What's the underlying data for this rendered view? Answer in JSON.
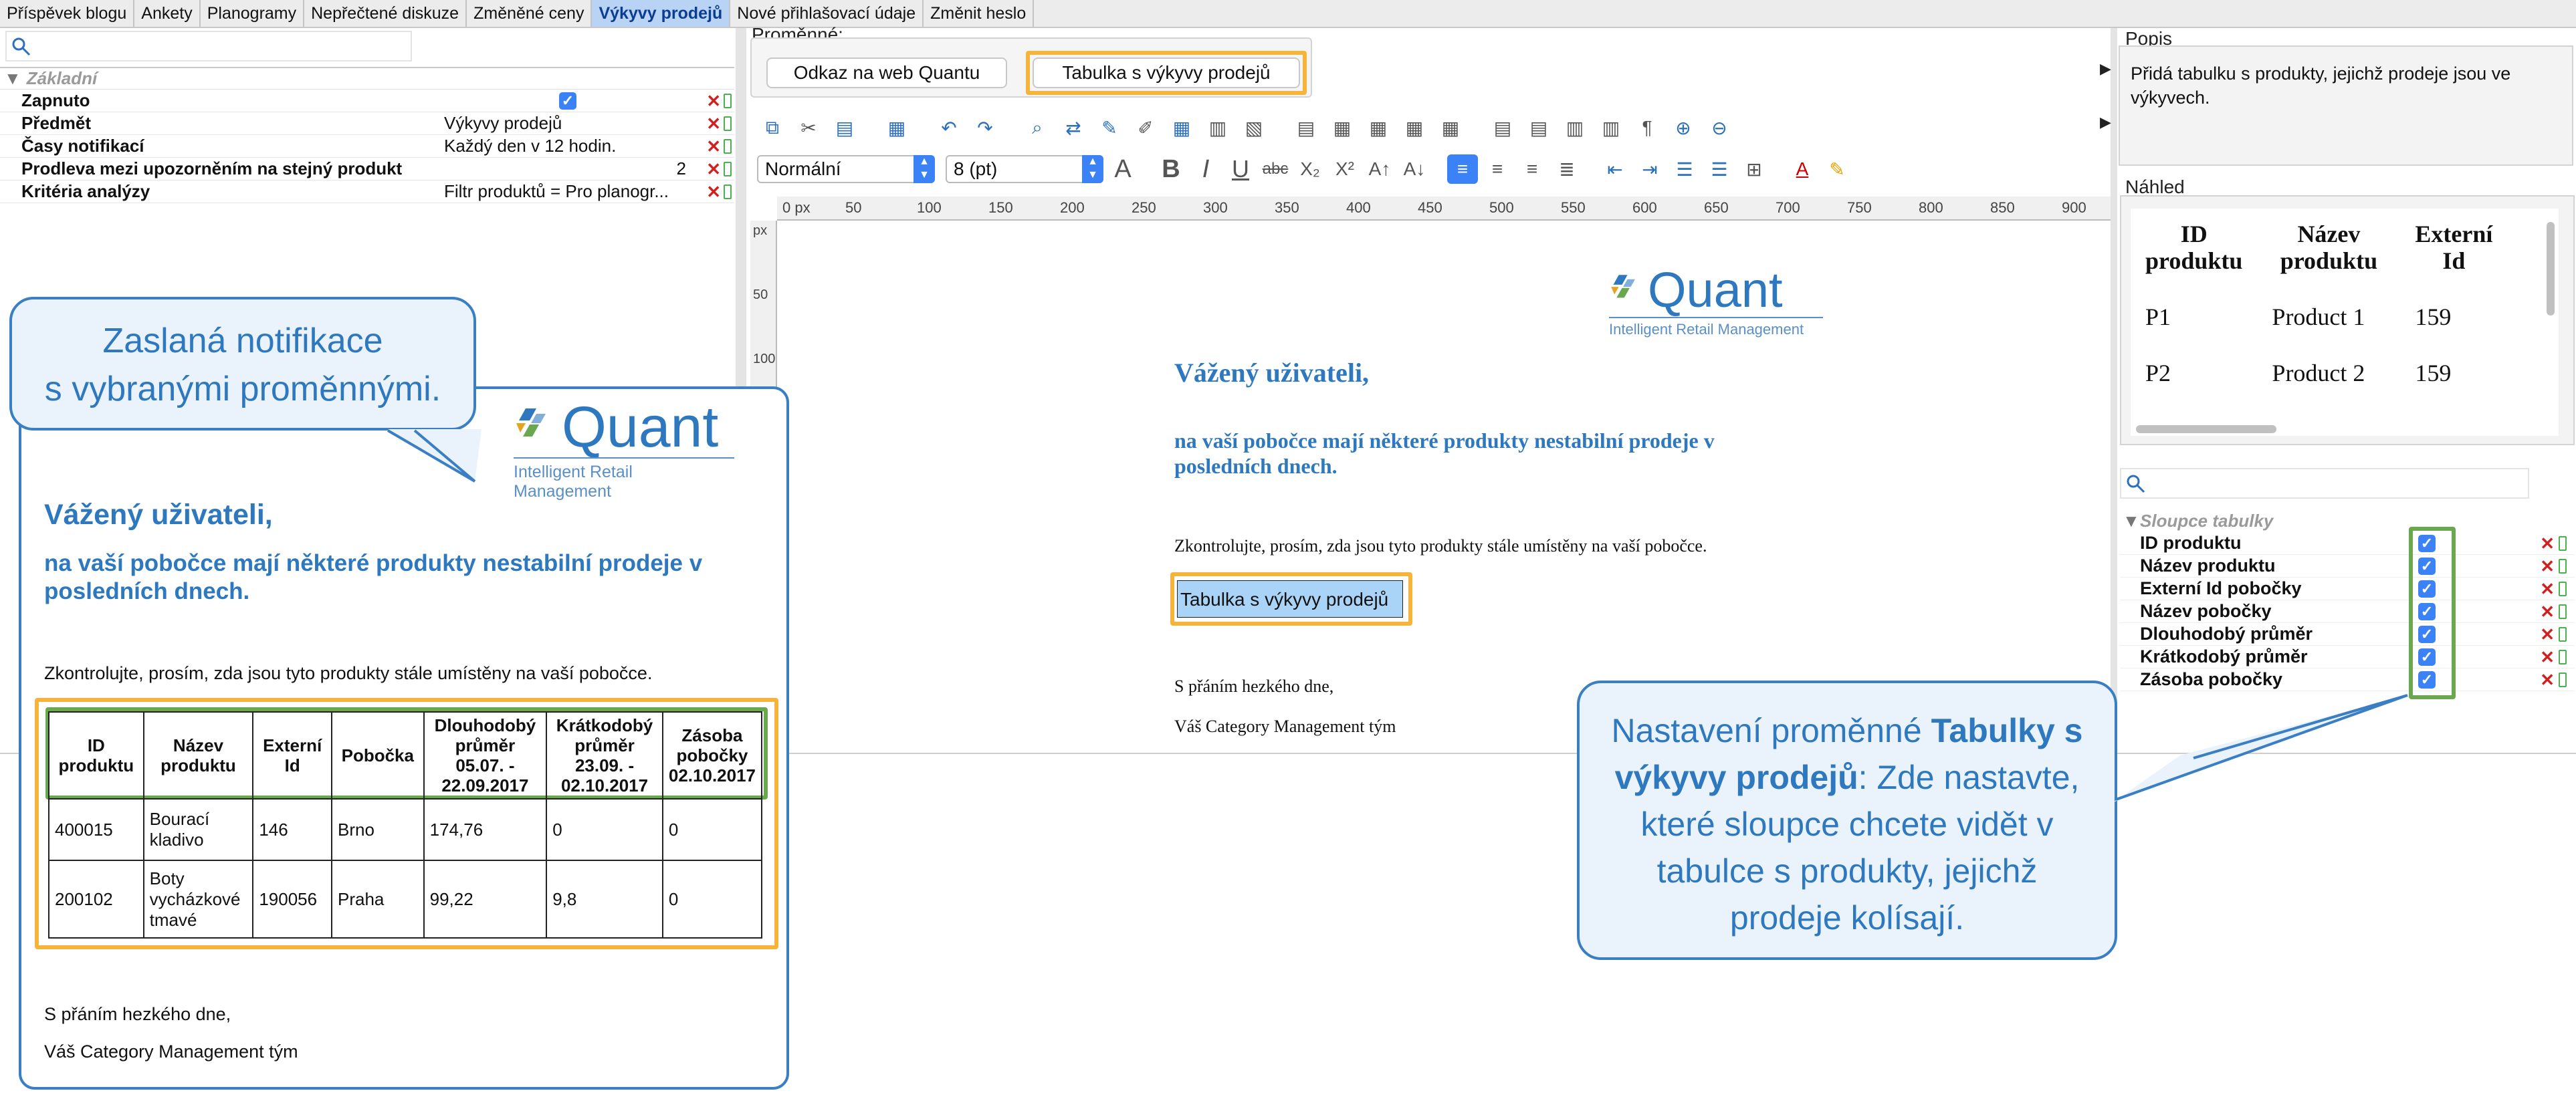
{
  "tabs": [
    {
      "label": "Příspěvek blogu",
      "active": false
    },
    {
      "label": "Ankety",
      "active": false
    },
    {
      "label": "Planogramy",
      "active": false
    },
    {
      "label": "Nepřečtené diskuze",
      "active": false
    },
    {
      "label": "Změněné ceny",
      "active": false
    },
    {
      "label": "Výkyvy prodejů",
      "active": true
    },
    {
      "label": "Nové přihlašovací údaje",
      "active": false
    },
    {
      "label": "Změnit heslo",
      "active": false
    }
  ],
  "properties": {
    "section": "Základní",
    "rows": [
      {
        "name": "Zapnuto",
        "value": "",
        "checkbox": true
      },
      {
        "name": "Předmět",
        "value": "Výkyvy prodejů"
      },
      {
        "name": "Časy notifikací",
        "value": "Každý den v 12 hodin."
      },
      {
        "name": "Prodleva mezi upozorněním na stejný produkt",
        "value": "2"
      },
      {
        "name": "Kritéria analýzy",
        "value": "Filtr produktů = Pro planogr..."
      }
    ]
  },
  "callout1": {
    "line1": "Zaslaná notifikace",
    "line2": "s vybranými proměnnými."
  },
  "callout2": {
    "pre": "Nastavení proměnné ",
    "bold": "Tabulky s výkyvy prodejů",
    "post": ": Zde nastavte, které sloupce chcete vidět v tabulce s produkty, jejichž prodeje kolísají."
  },
  "logo": {
    "name": "Quant",
    "tagline": "Intelligent Retail Management"
  },
  "email": {
    "greeting": "Vážený uživateli,",
    "intro": "na vaší pobočce mají některé produkty nestabilní prodeje v posledních dnech.",
    "check": "Zkontrolujte, prosím, zda jsou tyto produkty stále umístěny na vaší pobočce.",
    "closing": "S přáním hezkého dne,",
    "signature": "Váš Category Management tým",
    "table": {
      "headers": [
        "ID produktu",
        "Název produktu",
        "Externí Id",
        "Pobočka",
        "Dlouhodobý průměr 05.07. - 22.09.2017",
        "Krátkodobý průměr 23.09. - 02.10.2017",
        "Zásoba pobočky 02.10.2017"
      ],
      "rows": [
        [
          "400015",
          "Bourací kladivo",
          "146",
          "Brno",
          "174,76",
          "0",
          "0"
        ],
        [
          "200102",
          "Boty vycházkové tmavé",
          "190056",
          "Praha",
          "99,22",
          "9,8",
          "0"
        ]
      ]
    }
  },
  "variables": {
    "label": "Proměnné:",
    "buttons": [
      "Odkaz na web Quantu",
      "Tabulka s výkyvy prodejů"
    ]
  },
  "format": {
    "style": "Normální",
    "size": "8 (pt)"
  },
  "ruler": {
    "unit": "0 px",
    "ticks": [
      "50",
      "100",
      "150",
      "200",
      "250",
      "300",
      "350",
      "400",
      "450",
      "500",
      "550",
      "600",
      "650",
      "700",
      "750",
      "800",
      "850",
      "900"
    ],
    "vunit": "px",
    "vticks": [
      "50",
      "100"
    ]
  },
  "editor": {
    "greeting": "Vážený uživateli,",
    "intro": "na vaší pobočce mají některé produkty nestabilní prodeje v posledních dnech.",
    "check": "Zkontrolujte, prosím, zda jsou tyto produkty stále umístěny na vaší pobočce.",
    "variable_chip": "Tabulka s výkyvy prodejů",
    "closing": "S přáním hezkého dne,",
    "signature": "Váš Category Management tým"
  },
  "description": {
    "label": "Popis",
    "text": "Přidá tabulku s produkty, jejichž prodeje jsou ve výkyvech."
  },
  "preview": {
    "label": "Náhled",
    "headers": [
      "ID produktu",
      "Název produktu",
      "Externí Id"
    ],
    "rows": [
      [
        "P1",
        "Product 1",
        "159"
      ],
      [
        "P2",
        "Product 2",
        "159"
      ]
    ]
  },
  "columns": {
    "section": "Sloupce tabulky",
    "items": [
      "ID produktu",
      "Název produktu",
      "Externí Id pobočky",
      "Název pobočky",
      "Dlouhodobý průměr",
      "Krátkodobý průměr",
      "Zásoba pobočky"
    ]
  },
  "colors": {
    "accent": "#2e78bf",
    "highlight_orange": "#f6b43a",
    "highlight_green": "#6aa84f",
    "active_tab": "#b9d3f5"
  }
}
